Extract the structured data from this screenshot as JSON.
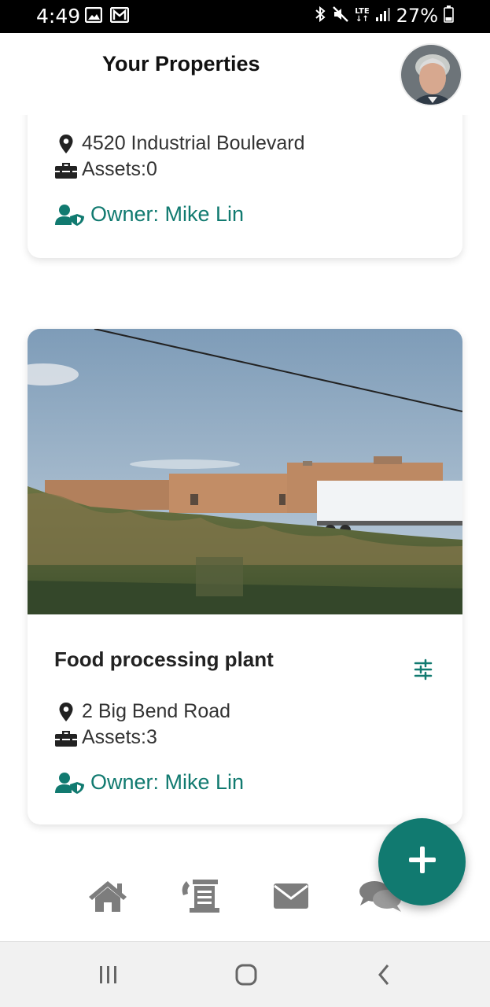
{
  "status_bar": {
    "time": "4:49",
    "battery": "27%",
    "network": "LTE",
    "left_icons": [
      "image-icon",
      "gmail-icon"
    ],
    "right_icons": [
      "bluetooth-icon",
      "mute-icon",
      "lte-icon",
      "signal-icon",
      "battery-icon"
    ]
  },
  "header": {
    "title": "Your Properties",
    "avatar": "profile-avatar"
  },
  "properties": [
    {
      "title": "",
      "address": "4520 Industrial Boulevard",
      "assets": "Assets:0",
      "owner": "Owner: Mike Lin"
    },
    {
      "title": "Food processing plant",
      "address": "2 Big Bend Road",
      "assets": "Assets:3",
      "owner": "Owner: Mike Lin",
      "image": "industrial-building-photo"
    }
  ],
  "fab": {
    "icon": "plus-icon"
  },
  "bottom_nav": [
    "home-icon",
    "reception-desk-icon",
    "mail-icon",
    "chat-icon"
  ],
  "system_nav": [
    "recent-apps-icon",
    "home-button-icon",
    "back-icon"
  ],
  "colors": {
    "accent": "#117a70",
    "nav_icon": "#7d7d7d",
    "text": "#333333"
  }
}
